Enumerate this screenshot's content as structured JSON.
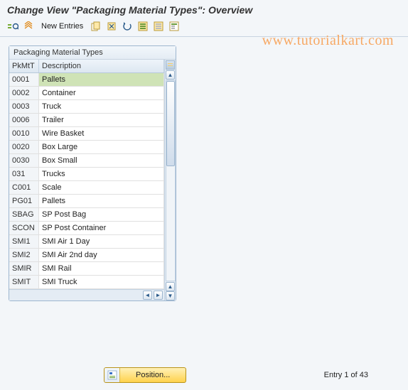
{
  "title": "Change View \"Packaging Material Types\": Overview",
  "toolbar": {
    "new_entries": "New Entries"
  },
  "watermark": "www.tutorialkart.com",
  "panel": {
    "title": "Packaging Material Types",
    "columns": {
      "code": "PkMtT",
      "desc": "Description"
    },
    "rows": [
      {
        "code": "0001",
        "desc": "Pallets"
      },
      {
        "code": "0002",
        "desc": "Container"
      },
      {
        "code": "0003",
        "desc": "Truck"
      },
      {
        "code": "0006",
        "desc": "Trailer"
      },
      {
        "code": "0010",
        "desc": "Wire Basket"
      },
      {
        "code": "0020",
        "desc": "Box Large"
      },
      {
        "code": "0030",
        "desc": "Box Small"
      },
      {
        "code": "031",
        "desc": "Trucks"
      },
      {
        "code": "C001",
        "desc": "Scale"
      },
      {
        "code": "PG01",
        "desc": "Pallets"
      },
      {
        "code": "SBAG",
        "desc": "SP Post Bag"
      },
      {
        "code": "SCON",
        "desc": "SP Post Container"
      },
      {
        "code": "SMI1",
        "desc": "SMI Air 1 Day"
      },
      {
        "code": "SMI2",
        "desc": "SMI Air 2nd day"
      },
      {
        "code": "SMIR",
        "desc": "SMI Rail"
      },
      {
        "code": "SMIT",
        "desc": "SMI Truck"
      }
    ]
  },
  "footer": {
    "position_label": "Position...",
    "entry_text": "Entry 1 of 43"
  }
}
